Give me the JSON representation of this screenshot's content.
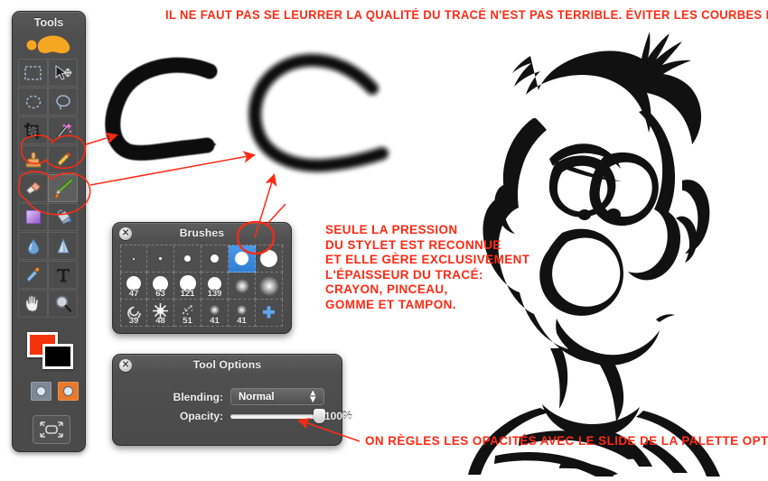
{
  "annotations": {
    "top_note": "IL NE FAUT PAS SE LEURRER LA QUALITÉ DU TRACÉ N'EST PAS TERRIBLE. ÉVITER LES COURBES RAPIDES...",
    "middle_note": "SEULE LA PRESSION\nDU STYLET EST RECONNUE\nET ELLE GÈRE EXCLUSIVEMENT\nL'ÉPAISSEUR DU TRACÉ:\nCRAYON, PINCEAU,\nGOMME ET TAMPON.",
    "bottom_note": "ON RÈGLES LES OPACITÉS AVEC LE SLIDE DE LA PALETTE OPTION.",
    "marker_color": "#ff2a14"
  },
  "tools_palette": {
    "title": "Tools",
    "logo_icon": "blob-logo-icon",
    "tools": [
      {
        "name": "rectangle-select",
        "icon": "rectangle-select-icon",
        "selected": false
      },
      {
        "name": "move",
        "icon": "move-arrow-icon",
        "selected": false
      },
      {
        "name": "ellipse-select",
        "icon": "ellipse-select-icon",
        "selected": false
      },
      {
        "name": "lasso",
        "icon": "lasso-icon",
        "selected": false
      },
      {
        "name": "crop",
        "icon": "crop-icon",
        "selected": false
      },
      {
        "name": "magic-wand",
        "icon": "magic-wand-icon",
        "selected": false
      },
      {
        "name": "stamp",
        "icon": "stamp-icon",
        "selected": false
      },
      {
        "name": "pencil",
        "icon": "pencil-icon",
        "selected": false
      },
      {
        "name": "eraser",
        "icon": "eraser-icon",
        "selected": false
      },
      {
        "name": "paintbrush",
        "icon": "paintbrush-icon",
        "selected": true
      },
      {
        "name": "gradient",
        "icon": "gradient-icon",
        "selected": false
      },
      {
        "name": "paint-bucket",
        "icon": "paint-bucket-icon",
        "selected": false
      },
      {
        "name": "blur",
        "icon": "water-drop-icon",
        "selected": false
      },
      {
        "name": "sharpen",
        "icon": "cone-icon",
        "selected": false
      },
      {
        "name": "eyedropper",
        "icon": "eyedropper-icon",
        "selected": false
      },
      {
        "name": "text",
        "icon": "text-t-icon",
        "selected": false
      },
      {
        "name": "hand",
        "icon": "hand-icon",
        "selected": false
      },
      {
        "name": "zoom",
        "icon": "magnifier-icon",
        "selected": false
      }
    ],
    "foreground_color": "#f4330d",
    "background_color": "#000000",
    "mask_buttons": [
      {
        "name": "standard-mask",
        "color": "#7d8896"
      },
      {
        "name": "quick-mask",
        "color": "#e8792a"
      }
    ],
    "fullscreen_icon": "fullscreen-icon"
  },
  "brushes_palette": {
    "title": "Brushes",
    "close_glyph": "✕",
    "add_glyph": "✚",
    "rows": [
      [
        {
          "label": "",
          "size": 2,
          "soft": false,
          "selected": false
        },
        {
          "label": "",
          "size": 3,
          "soft": false,
          "selected": false
        },
        {
          "label": "",
          "size": 7,
          "soft": false,
          "selected": false
        },
        {
          "label": "",
          "size": 9,
          "soft": false,
          "selected": false
        },
        {
          "label": "",
          "size": 15,
          "soft": false,
          "selected": true
        },
        {
          "label": "",
          "size": 19,
          "soft": false,
          "selected": false
        }
      ],
      [
        {
          "label": "47",
          "size": 16,
          "soft": false,
          "selected": false
        },
        {
          "label": "63",
          "size": 17,
          "soft": false,
          "selected": false
        },
        {
          "label": "121",
          "size": 18,
          "soft": false,
          "selected": false
        },
        {
          "label": "139",
          "size": 15,
          "soft": false,
          "selected": false
        },
        {
          "label": "",
          "size": 14,
          "soft": true,
          "selected": false
        },
        {
          "label": "",
          "size": 20,
          "soft": true,
          "selected": false
        }
      ],
      [
        {
          "label": "39",
          "size": 18,
          "soft": false,
          "selected": false,
          "icon": "spiral-brush-icon"
        },
        {
          "label": "48",
          "size": 18,
          "soft": false,
          "selected": false,
          "icon": "star-brush-icon"
        },
        {
          "label": "51",
          "size": 16,
          "soft": false,
          "selected": false,
          "icon": "spatter-brush-icon"
        },
        {
          "label": "41",
          "size": 9,
          "soft": true,
          "selected": false
        },
        {
          "label": "41",
          "size": 9,
          "soft": true,
          "selected": false
        },
        {
          "label": "",
          "size": 0,
          "soft": false,
          "selected": false,
          "icon": "plus-icon"
        }
      ]
    ]
  },
  "tool_options_palette": {
    "title": "Tool Options",
    "close_glyph": "✕",
    "blending_label": "Blending:",
    "blending_value": "Normal",
    "opacity_label": "Opacity:",
    "opacity_value": "100%",
    "opacity_percent": 100
  }
}
